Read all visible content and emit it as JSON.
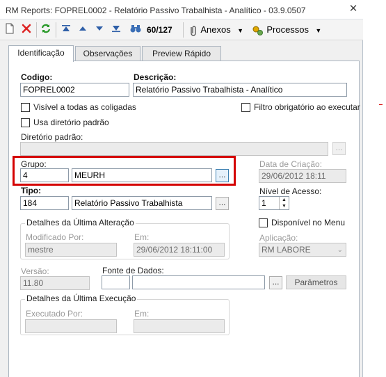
{
  "window": {
    "title": "RM Reports: FOPREL0002 - Relatório Passivo Trabalhista - Analítico - 03.9.0507"
  },
  "toolbar": {
    "record_counter": "60/127",
    "anexos_label": "Anexos",
    "processos_label": "Processos"
  },
  "tabs": [
    {
      "label": "Identificação"
    },
    {
      "label": "Observações"
    },
    {
      "label": "Preview Rápido"
    }
  ],
  "form": {
    "codigo_label": "Codigo:",
    "codigo_value": "FOPREL0002",
    "descricao_label": "Descrição:",
    "descricao_value": "Relatório Passivo Trabalhista - Analítico",
    "visivel_label": "Visível a todas as coligadas",
    "filtro_label": "Filtro obrigatório ao executar",
    "usa_diretorio_label": "Usa diretório padrão",
    "diretorio_label": "Diretório padrão:",
    "diretorio_value": "",
    "grupo_label": "Grupo:",
    "grupo_code": "4",
    "grupo_name": "MEURH",
    "data_criacao_label": "Data de Criação:",
    "data_criacao_value": "29/06/2012 18:11",
    "tipo_label": "Tipo:",
    "tipo_code": "184",
    "tipo_name": "Relatório Passivo Trabalhista",
    "nivel_acesso_label": "Nível de Acesso:",
    "nivel_acesso_value": "1",
    "ultima_alteracao_title": "Detalhes da Última Alteração",
    "modificado_por_label": "Modificado Por:",
    "modificado_por_value": "mestre",
    "em_label": "Em:",
    "modificado_em_value": "29/06/2012 18:11:00",
    "disponivel_menu_label": "Disponível no Menu",
    "aplicacao_label": "Aplicação:",
    "aplicacao_value": "RM LABORE",
    "versao_label": "Versão:",
    "versao_value": "11.80",
    "fonte_dados_label": "Fonte de Dados:",
    "fonte_code": "",
    "fonte_name": "",
    "parametros_label": "Parâmetros",
    "ultima_execucao_title": "Detalhes da Última Execução",
    "executado_por_label": "Executado Por:",
    "executado_por_value": "",
    "executado_em_label": "Em:",
    "executado_em_value": "",
    "ellipsis": "..."
  },
  "colors": {
    "highlight_border": "#d40000",
    "focus_blue": "#3c7fb1"
  }
}
